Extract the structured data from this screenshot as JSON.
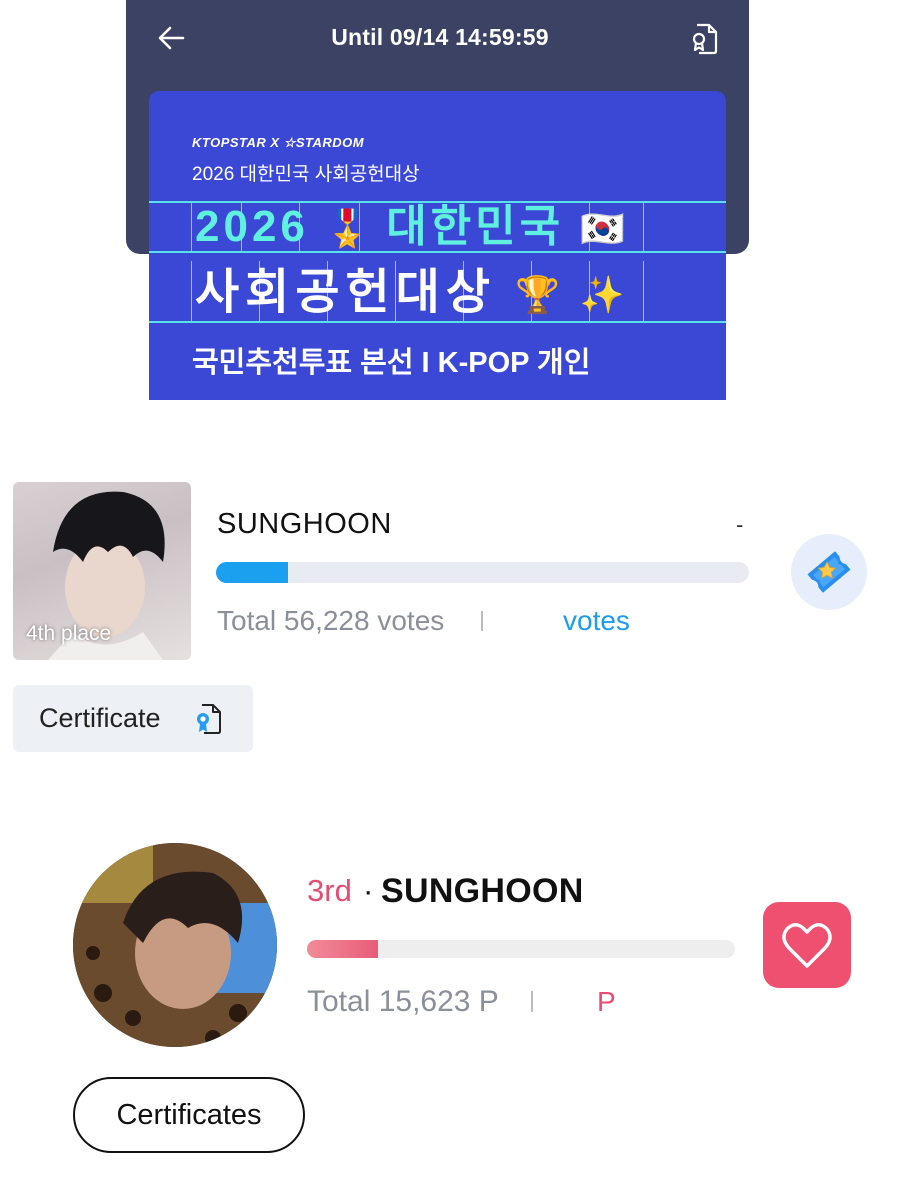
{
  "header": {
    "deadline_text": "Until 09/14 14:59:59",
    "back_icon": "back-arrow-icon",
    "certificate_icon": "certificate-document-icon",
    "background_color": "#3b4264"
  },
  "banner": {
    "brand": "KTOPSTAR X ☆STARDOM",
    "subtitle": "2026 대한민국 사회공헌대상",
    "line1_text": "2026",
    "line1_korean": "대한민국",
    "line2_text": "사회공헌대상",
    "line3": "국민추천투표 본선 I K-POP 개인",
    "emojis": [
      "🎖️",
      "🇰🇷",
      "🏆",
      "✨"
    ],
    "background_color": "#3b48d6",
    "accent_color": "#5ff0e0"
  },
  "candidate1": {
    "name": "SUNGHOON",
    "place": "4th place",
    "dash": "-",
    "total": "Total 56,228 votes",
    "my_votes_label": "votes",
    "progress_fraction": 0.135,
    "bar_color": "#1aa0ef",
    "vote_button_icon": "ticket-star-icon",
    "certificate_label": "Certificate"
  },
  "candidate2": {
    "rank": "3rd",
    "separator": "·",
    "name": "SUNGHOON",
    "total": "Total 15,623 P",
    "my_points_label": "P",
    "progress_fraction": 0.166,
    "bar_color": "#e85c79",
    "vote_button_icon": "heart-icon",
    "certificates_label": "Certificates"
  }
}
